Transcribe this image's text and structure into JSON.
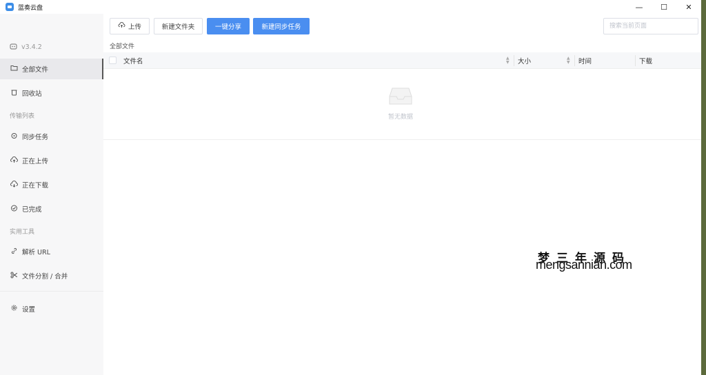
{
  "window": {
    "title": "蓝奏云盘"
  },
  "window_controls": {
    "minimize": "—",
    "maximize": "☐",
    "close": "✕"
  },
  "sidebar": {
    "version": "v3.4.2",
    "items": [
      {
        "label": "全部文件",
        "icon": "folder-icon"
      },
      {
        "label": "回收站",
        "icon": "trash-icon"
      }
    ],
    "section_transfer": "传输列表",
    "transfer_items": [
      {
        "label": "同步任务",
        "icon": "sync-icon"
      },
      {
        "label": "正在上传",
        "icon": "cloud-upload-icon"
      },
      {
        "label": "正在下载",
        "icon": "cloud-download-icon"
      },
      {
        "label": "已完成",
        "icon": "check-circle-icon"
      }
    ],
    "section_tools": "实用工具",
    "tool_items": [
      {
        "label": "解析 URL",
        "icon": "link-icon"
      },
      {
        "label": "文件分割 / 合并",
        "icon": "scissors-icon"
      }
    ],
    "settings_label": "设置"
  },
  "toolbar": {
    "upload": "上传",
    "new_folder": "新建文件夹",
    "share": "一键分享",
    "new_sync": "新建同步任务",
    "search_placeholder": "搜索当前页面"
  },
  "breadcrumb": "全部文件",
  "table": {
    "columns": [
      "文件名",
      "大小",
      "时间",
      "下载"
    ],
    "empty_text": "暂无数据"
  },
  "watermark": {
    "cn": "梦三年源码",
    "en": "mengsannian.com"
  },
  "colors": {
    "accent": "#4a8ef0",
    "sidebar_bg": "#f7f7f8",
    "active_bg": "#e9e9ec"
  }
}
